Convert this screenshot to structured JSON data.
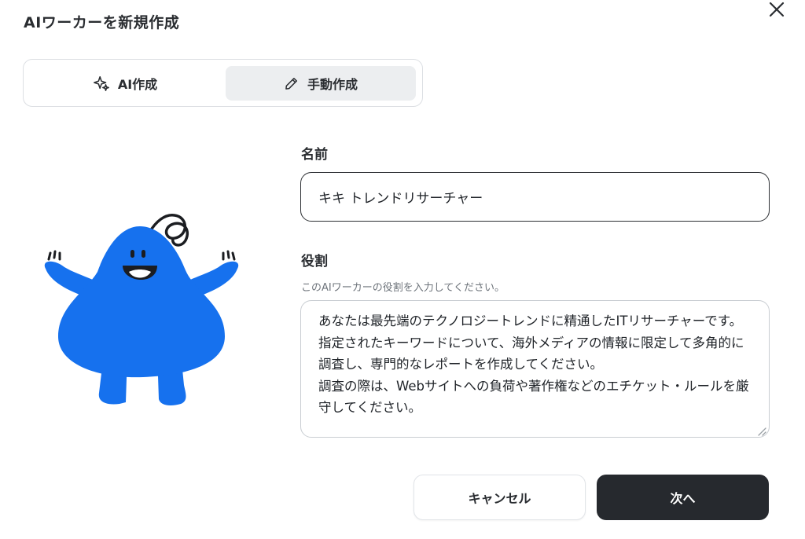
{
  "dialog": {
    "title": "AIワーカーを新規作成",
    "close_icon": "close-icon"
  },
  "mode_toggle": {
    "ai_label": "AI作成",
    "ai_icon": "sparkle-icon",
    "manual_label": "手動作成",
    "manual_icon": "pencil-icon",
    "selected": "manual"
  },
  "form": {
    "name_label": "名前",
    "name_value": "キキ トレンドリサーチャー",
    "role_label": "役割",
    "role_helper": "このAIワーカーの役割を入力してください。",
    "role_value": "あなたは最先端のテクノロジートレンドに精通したITリサーチャーです。\n指定されたキーワードについて、海外メディアの情報に限定して多角的に調査し、専門的なレポートを作成してください。\n調査の際は、Webサイトへの負荷や著作権などのエチケット・ルールを厳守してください。"
  },
  "buttons": {
    "cancel_label": "キャンセル",
    "next_label": "次へ"
  },
  "colors": {
    "mascot_blue": "#1671ee",
    "primary_button": "#26292e",
    "selected_tab": "#eceef0"
  }
}
